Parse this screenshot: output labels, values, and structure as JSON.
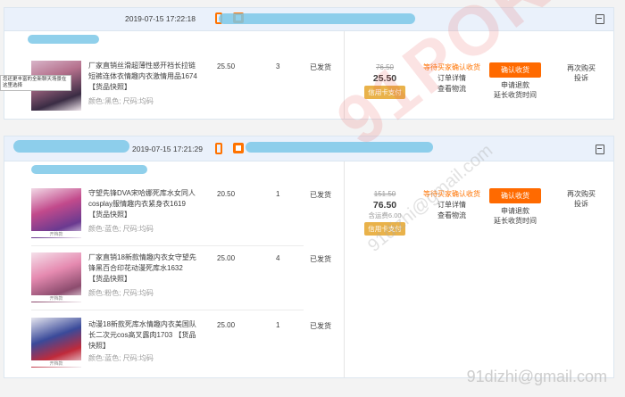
{
  "orders": [
    {
      "time": "2019-07-15 17:22:18",
      "items": [
        {
          "title": "厂家直销丝滑超薄性感开裆长拉链短裤连体衣情趣内衣激情用品1674",
          "snapshot": "【货品快照】",
          "attrs": "颜色:黑色; 尺码:均码",
          "price": "25.50",
          "qty": "3",
          "status": "已发货",
          "thumb_tag": ""
        }
      ],
      "summary": {
        "original": "76.50",
        "paid": "25.50",
        "shipping": "",
        "credit_badge": "信用卡支付",
        "state": "等待买家确认收货",
        "detail_link": "订单详情",
        "logistics_link": "查看物流",
        "confirm_button": "确认收货",
        "refund_link": "申请退款",
        "extend_link": "延长收货时间",
        "rebuy_link": "再次购买",
        "complain_link": "投诉"
      }
    },
    {
      "time": "2019-07-15 17:21:29",
      "items": [
        {
          "title": "守望先锋DVA宋哈娜死库水女同人cosplay服情趣内衣紧身衣1619",
          "snapshot": "【货品快照】",
          "attrs": "颜色:蓝色; 尺码:均码",
          "price": "20.50",
          "qty": "1",
          "status": "已发货",
          "thumb_tag": "开档款"
        },
        {
          "title": "厂家直销18新款情趣内衣女守望先锋黑百合印花动漫死库水1632",
          "snapshot": "【货品快照】",
          "attrs": "颜色:粉色; 尺码:均码",
          "price": "25.00",
          "qty": "4",
          "status": "已发货",
          "thumb_tag": "开档款"
        },
        {
          "title": "动漫18新款死库水情趣内衣美国队长二次元cos高叉露肉1703",
          "snapshot": "【货品快照】",
          "attrs": "颜色:蓝色; 尺码:均码",
          "price": "25.00",
          "qty": "1",
          "status": "已发货",
          "thumb_tag": "开档款"
        }
      ],
      "summary": {
        "original": "151.50",
        "paid": "76.50",
        "shipping": "含运费6.00",
        "credit_badge": "信用卡支付",
        "state": "等待买家确认收货",
        "detail_link": "订单详情",
        "logistics_link": "查看物流",
        "confirm_button": "确认收货",
        "refund_link": "申请退款",
        "extend_link": "延长收货时间",
        "rebuy_link": "再次购买",
        "complain_link": "投诉"
      }
    }
  ],
  "popup_text": "您还更丰富的全新聊天场景在这里选择",
  "watermarks": {
    "big": "91PORN",
    "diagonal_mail": "91dizhi@gmail.com",
    "corner_mail": "91dizhi@gmail.com"
  },
  "colors": {
    "accent": "#ff6a00",
    "header_bg": "#eaf1fb",
    "credit_badge": "#e9b24a"
  }
}
